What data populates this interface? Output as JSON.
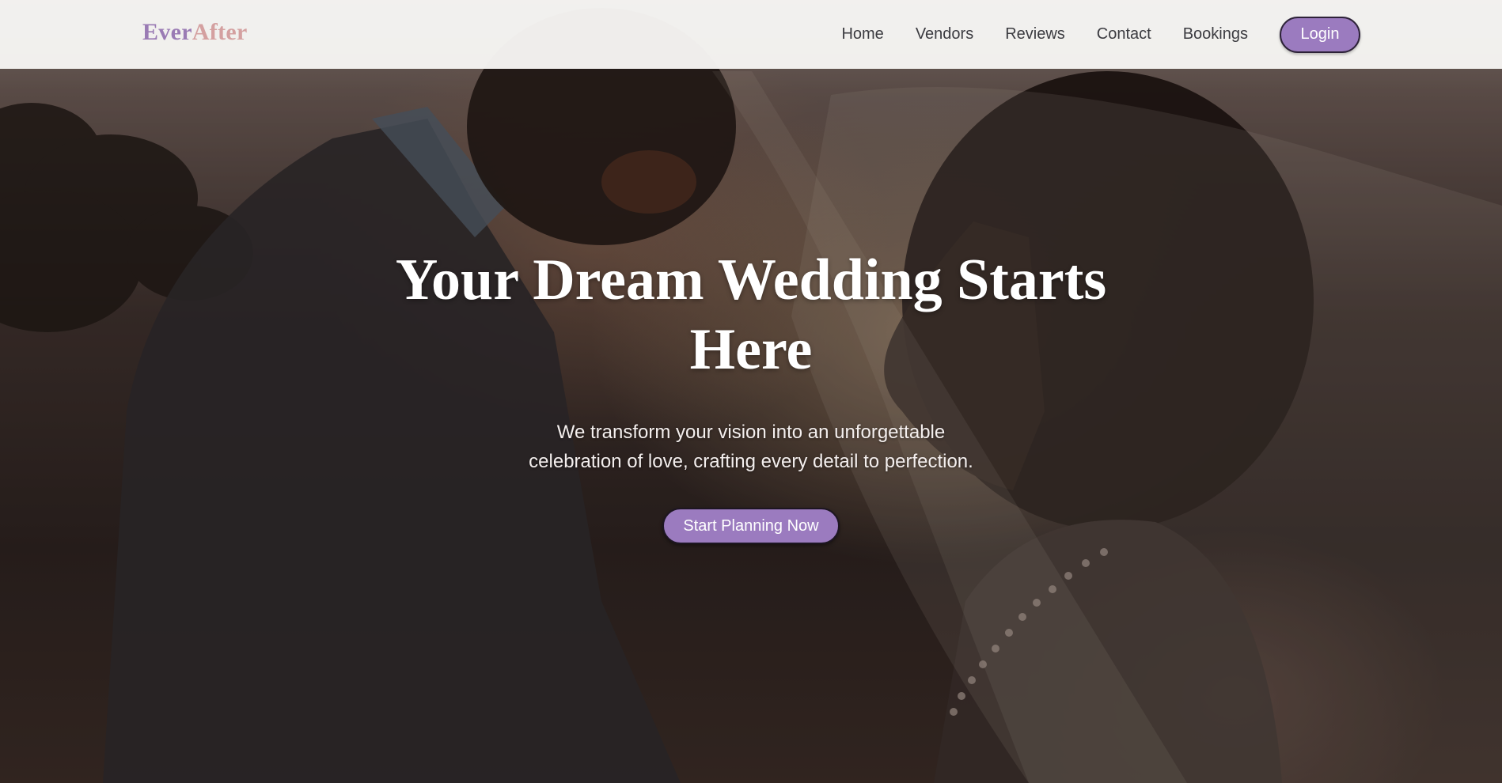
{
  "brand": {
    "logo_part1": "Ever",
    "logo_part2": "After",
    "colors": {
      "logo_ever": "#9a7bb4",
      "logo_after": "#d4a0a0",
      "accent": "#9b7bbf"
    }
  },
  "nav": {
    "items": [
      {
        "label": "Home"
      },
      {
        "label": "Vendors"
      },
      {
        "label": "Reviews"
      },
      {
        "label": "Contact"
      },
      {
        "label": "Bookings"
      }
    ],
    "login_label": "Login"
  },
  "hero": {
    "title": "Your Dream Wedding Starts Here",
    "subtitle": "We transform your vision into an unforgettable celebration of love, crafting every detail to perfection.",
    "cta_label": "Start Planning Now"
  }
}
